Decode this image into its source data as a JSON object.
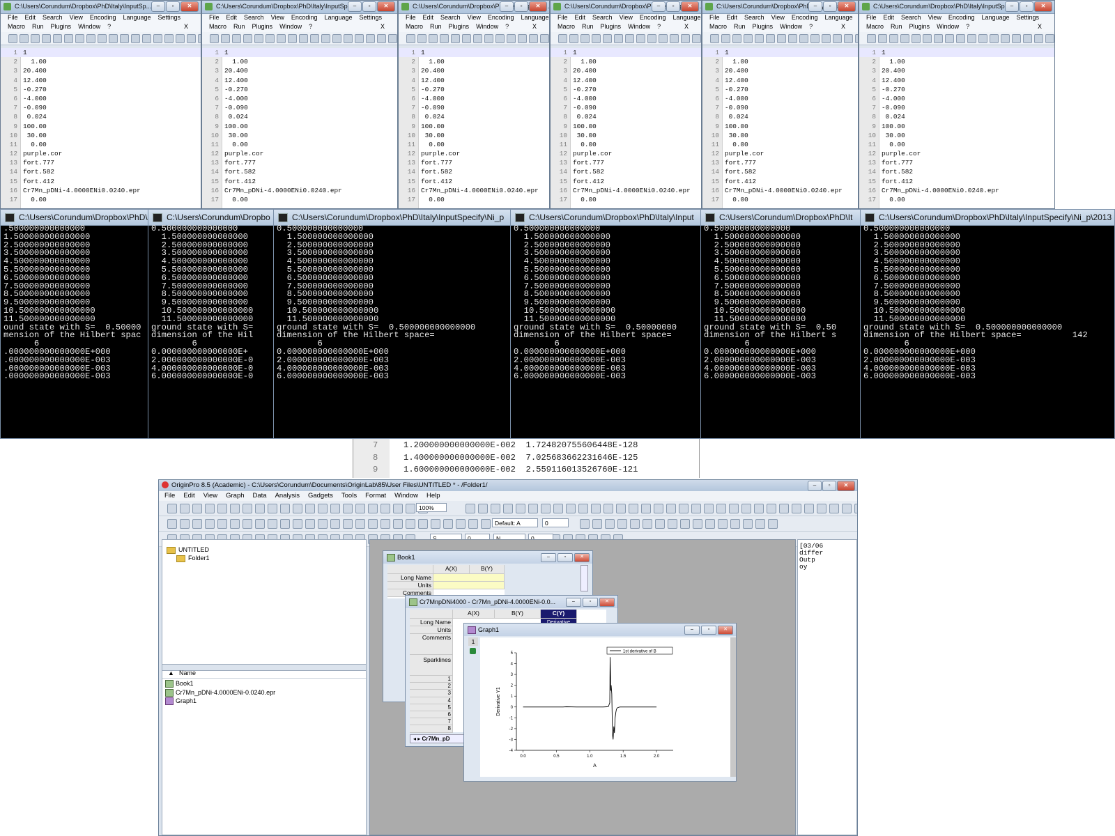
{
  "npp": {
    "titles": [
      "C:\\Users\\Corundum\\Dropbox\\PhD\\Italy\\InputSp...",
      "C:\\Users\\Corundum\\Dropbox\\PhD\\Italy\\InputSp...",
      "C:\\Users\\Corundum\\Dropbox\\PhD\\Italy\\InputSp...",
      "C:\\Users\\Corundum\\Dropbox\\PhD\\Italy\\InputSp...",
      "C:\\Users\\Corundum\\Dropbox\\PhD\\Italy\\InputSp...",
      "C:\\Users\\Corundum\\Dropbox\\PhD\\Italy\\InputSp..."
    ],
    "menu1": [
      "File",
      "Edit",
      "Search",
      "View",
      "Encoding",
      "Language",
      "Settings"
    ],
    "menu2": [
      "Macro",
      "Run",
      "Plugins",
      "Window",
      "?"
    ],
    "lines": [
      {
        "n": "1",
        "t": "1"
      },
      {
        "n": "2",
        "t": "  1.00"
      },
      {
        "n": "3",
        "t": "20.400"
      },
      {
        "n": "4",
        "t": "12.400"
      },
      {
        "n": "5",
        "t": "-0.270"
      },
      {
        "n": "6",
        "t": "-4.000"
      },
      {
        "n": "7",
        "t": "-0.090"
      },
      {
        "n": "8",
        "t": " 0.024"
      },
      {
        "n": "9",
        "t": "100.00"
      },
      {
        "n": "10",
        "t": " 30.00"
      },
      {
        "n": "11",
        "t": "  0.00"
      },
      {
        "n": "12",
        "t": "purple.cor"
      },
      {
        "n": "13",
        "t": "fort.777"
      },
      {
        "n": "14",
        "t": "fort.582"
      },
      {
        "n": "15",
        "t": "fort.412"
      },
      {
        "n": "16",
        "t": "Cr7Mn_pDNi-4.0000ENi0.0240.epr"
      },
      {
        "n": "17",
        "t": "  0.00"
      }
    ]
  },
  "consoles": [
    {
      "title": "C:\\Users\\Corundum\\Dropbox\\PhD\\Italy\\",
      "lines": [
        ".500000000000000",
        "1.500000000000000",
        "2.500000000000000",
        "3.500000000000000",
        "4.500000000000000",
        "5.500000000000000",
        "6.500000000000000",
        "7.500000000000000",
        "8.500000000000000",
        "9.500000000000000",
        "10.500000000000000",
        "11.500000000000000",
        "ound state with S=  0.50000",
        "mension of the Hilbert spac",
        "      6",
        ".000000000000000E+000",
        ".000000000000000E-003",
        ".000000000000000E-003",
        ".000000000000000E-003"
      ]
    },
    {
      "title": "C:\\Users\\Corundum\\Dropbo",
      "lines": [
        "0.500000000000000",
        "  1.500000000000000",
        "  2.500000000000000",
        "  3.500000000000000",
        "  4.500000000000000",
        "  5.500000000000000",
        "  6.500000000000000",
        "  7.500000000000000",
        "  8.500000000000000",
        "  9.500000000000000",
        "  10.500000000000000",
        "  11.500000000000000",
        "ground state with S=",
        "dimension of the Hil",
        "        6",
        "0.000000000000000E+",
        "2.000000000000000E-0",
        "4.000000000000000E-0",
        "6.000000000000000E-0"
      ]
    },
    {
      "title": "C:\\Users\\Corundum\\Dropbox\\PhD\\Italy\\InputSpecify\\Ni_p",
      "lines": [
        "0.500000000000000",
        "  1.500000000000000",
        "  2.500000000000000",
        "  3.500000000000000",
        "  4.500000000000000",
        "  5.500000000000000",
        "  6.500000000000000",
        "  7.500000000000000",
        "  8.500000000000000",
        "  9.500000000000000",
        "  10.500000000000000",
        "  11.500000000000000",
        "ground state with S=  0.500000000000000",
        "dimension of the Hilbert space=",
        "        6",
        "0.000000000000000E+000",
        "2.000000000000000E-003",
        "4.000000000000000E-003",
        "6.000000000000000E-003"
      ]
    },
    {
      "title": "C:\\Users\\Corundum\\Dropbox\\PhD\\Italy\\Input",
      "lines": [
        "0.500000000000000",
        "  1.500000000000000",
        "  2.500000000000000",
        "  3.500000000000000",
        "  4.500000000000000",
        "  5.500000000000000",
        "  6.500000000000000",
        "  7.500000000000000",
        "  8.500000000000000",
        "  9.500000000000000",
        "  10.500000000000000",
        "  11.500000000000000",
        "ground state with S=  0.50000000",
        "dimension of the Hilbert space=",
        "        6",
        "0.000000000000000E+000",
        "2.000000000000000E-003",
        "4.000000000000000E-003",
        "6.000000000000000E-003"
      ]
    },
    {
      "title": "C:\\Users\\Corundum\\Dropbox\\PhD\\It",
      "lines": [
        "0.500000000000000",
        "  1.500000000000000",
        "  2.500000000000000",
        "  3.500000000000000",
        "  4.500000000000000",
        "  5.500000000000000",
        "  6.500000000000000",
        "  7.500000000000000",
        "  8.500000000000000",
        "  9.500000000000000",
        "  10.500000000000000",
        "  11.500000000000000",
        "ground state with S=  0.50",
        "dimension of the Hilbert s",
        "        6",
        "0.000000000000000E+000",
        "2.000000000000000E-003",
        "4.000000000000000E-003",
        "6.000000000000000E-003"
      ]
    },
    {
      "title": "C:\\Users\\Corundum\\Dropbox\\PhD\\Italy\\InputSpecify\\Ni_p\\2013",
      "lines": [
        "0.500000000000000",
        "  1.500000000000000",
        "  2.500000000000000",
        "  3.500000000000000",
        "  4.500000000000000",
        "  5.500000000000000",
        "  6.500000000000000",
        "  7.500000000000000",
        "  8.500000000000000",
        "  9.500000000000000",
        "  10.500000000000000",
        "  11.500000000000000",
        "ground state with S=  0.500000000000000",
        "dimension of the Hilbert space=          142",
        "        6",
        "0.000000000000000E+000",
        "2.000000000000000E-003",
        "4.000000000000000E-003",
        "6.000000000000000E-003"
      ]
    }
  ],
  "behind": [
    {
      "n": "7",
      "t": "1.200000000000000E-002  1.724820755606448E-128"
    },
    {
      "n": "8",
      "t": "1.400000000000000E-002  7.025683662231646E-125"
    },
    {
      "n": "9",
      "t": "1.600000000000000E-002  2.559116013526760E-121"
    }
  ],
  "origin": {
    "title": "OriginPro 8.5 (Academic) - C:\\Users\\Corundum\\Documents\\OriginLab\\85\\User Files\\UNTITLED * - /Folder1/",
    "menu": [
      "File",
      "Edit",
      "View",
      "Graph",
      "Data",
      "Analysis",
      "Gadgets",
      "Tools",
      "Format",
      "Window",
      "Help"
    ],
    "zoom": "100%",
    "font_name": "Default: A",
    "font_size": "0",
    "line_style": "S",
    "line_width": "0",
    "color_label": "N",
    "tree_root": "UNTITLED",
    "tree_folder": "Folder1",
    "list_header": "Name",
    "list_items": [
      "Book1",
      "Cr7Mn_pDNi-4.0000ENi-0.0240.epr",
      "Graph1"
    ],
    "right_text": [
      "[03/06",
      "differ",
      "Outp",
      "oy"
    ],
    "book1": {
      "title": "Book1",
      "col_a": "A(X)",
      "col_b": "B(Y)",
      "rows": [
        "Long Name",
        "Units",
        "Comments"
      ]
    },
    "book2": {
      "title": "Cr7MnpDNi4000 - Cr7Mn_pDNi-4.0000ENi-0.0...",
      "col_a": "A(X)",
      "col_b": "B(Y)",
      "col_c": "C(Y)",
      "col_c_sub": "Derivative",
      "rows": [
        "Long Name",
        "Units",
        "Comments",
        "Sparklines"
      ],
      "row_nums": [
        "1",
        "2",
        "3",
        "4",
        "5",
        "6",
        "7",
        "8"
      ],
      "sheet_tab": "Cr7Mn_pD"
    },
    "graph": {
      "title": "Graph1",
      "layer": "1"
    }
  },
  "chart_data": {
    "type": "line",
    "xlabel": "A",
    "ylabel": "Derivative Y1",
    "xlim": [
      -0.1,
      2.25
    ],
    "ylim": [
      -4,
      5
    ],
    "xticks": [
      "0.0",
      "0.5",
      "1.0",
      "1.5",
      "2.0"
    ],
    "yticks": [
      "-4",
      "-3",
      "-2",
      "-1",
      "0",
      "1",
      "2",
      "3",
      "4",
      "5"
    ],
    "legend": "1st derivative of B",
    "legend_position": "top-right",
    "series": [
      {
        "name": "1st derivative of B",
        "x": [
          0.0,
          0.4,
          0.6,
          0.65,
          0.8,
          1.0,
          1.2,
          1.26,
          1.28,
          1.3,
          1.305,
          1.31,
          1.315,
          1.32,
          1.33,
          1.34,
          1.35,
          1.36,
          1.37,
          1.38,
          1.39,
          1.4,
          1.42,
          1.45,
          1.6,
          2.0
        ],
        "values": [
          0.0,
          0.0,
          0.0,
          0.02,
          0.0,
          0.0,
          0.0,
          0.02,
          0.05,
          0.4,
          4.6,
          3.2,
          1.5,
          2.0,
          1.2,
          -2.5,
          -3.0,
          -1.8,
          -2.4,
          -1.0,
          -0.5,
          -0.2,
          -0.05,
          0.0,
          0.0,
          0.0
        ]
      }
    ]
  }
}
